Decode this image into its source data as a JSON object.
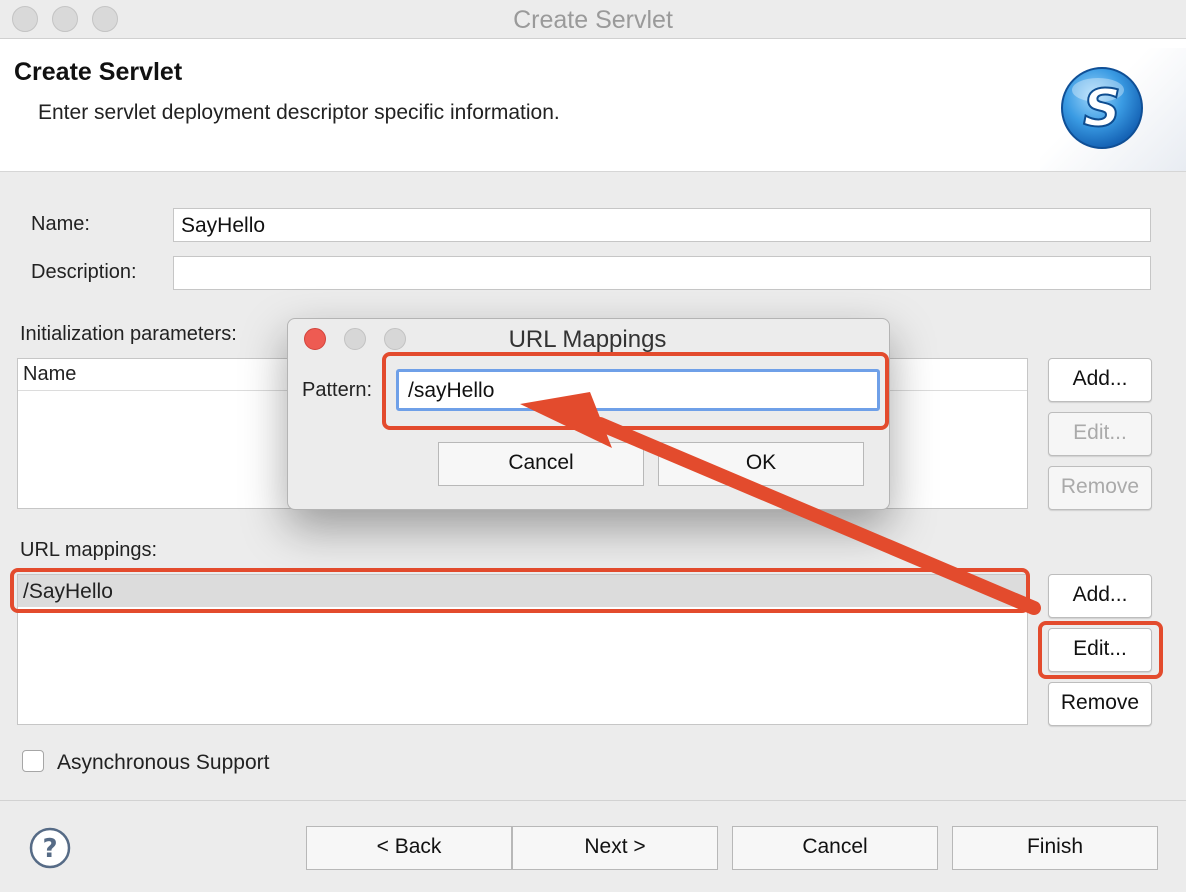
{
  "window": {
    "title": "Create Servlet"
  },
  "header": {
    "title": "Create Servlet",
    "subtitle": "Enter servlet deployment descriptor specific information."
  },
  "form": {
    "name_label": "Name:",
    "name_value": "SayHello",
    "description_label": "Description:",
    "description_value": ""
  },
  "init_params": {
    "label": "Initialization parameters:",
    "column_name": "Name",
    "add_label": "Add...",
    "edit_label": "Edit...",
    "remove_label": "Remove"
  },
  "url_mappings": {
    "label": "URL mappings:",
    "items": [
      "/SayHello"
    ],
    "add_label": "Add...",
    "edit_label": "Edit...",
    "remove_label": "Remove"
  },
  "async": {
    "label": "Asynchronous Support",
    "checked": false
  },
  "footer": {
    "back_label": "< Back",
    "next_label": "Next >",
    "cancel_label": "Cancel",
    "finish_label": "Finish"
  },
  "dialog": {
    "title": "URL Mappings",
    "pattern_label": "Pattern:",
    "pattern_value": "/sayHello",
    "cancel_label": "Cancel",
    "ok_label": "OK"
  },
  "colors": {
    "annotation": "#e34b2d",
    "focus": "#6fa0e8",
    "close_light": "#ee5b52"
  },
  "icons": [
    "servlet-logo-icon",
    "help-icon",
    "annotation-arrow"
  ]
}
